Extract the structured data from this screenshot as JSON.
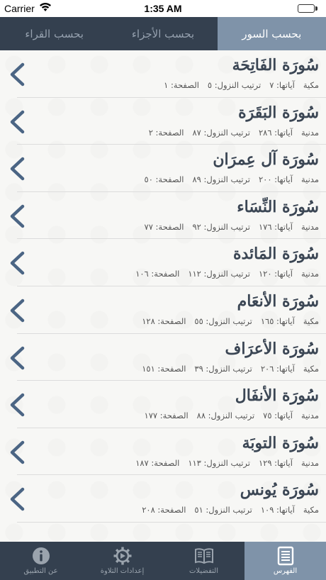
{
  "status_bar": {
    "carrier": "Carrier",
    "time": "1:35 AM"
  },
  "tabs": [
    {
      "label": "بحسب القراء",
      "active": false
    },
    {
      "label": "بحسب الأجزاء",
      "active": false
    },
    {
      "label": "بحسب السور",
      "active": true
    }
  ],
  "surahs": [
    {
      "name": "سُورَة الفَاتِحَة",
      "type": "مكية",
      "ayat": "آياتها: ٧",
      "order": "ترتيب النزول: ٥",
      "page": "الصفحة: ١"
    },
    {
      "name": "سُورَة البَقَرَة",
      "type": "مدنية",
      "ayat": "آياتها: ٢٨٦",
      "order": "ترتيب النزول: ٨٧",
      "page": "الصفحة: ٢"
    },
    {
      "name": "سُورَة آل عِمرَان",
      "type": "مدنية",
      "ayat": "آياتها: ٢٠٠",
      "order": "ترتيب النزول: ٨٩",
      "page": "الصفحة: ٥٠"
    },
    {
      "name": "سُورَة النِّسَاء",
      "type": "مدنية",
      "ayat": "آياتها: ١٧٦",
      "order": "ترتيب النزول: ٩٢",
      "page": "الصفحة: ٧٧"
    },
    {
      "name": "سُورَة المَائدة",
      "type": "مدنية",
      "ayat": "آياتها: ١٢٠",
      "order": "ترتيب النزول: ١١٢",
      "page": "الصفحة: ١٠٦"
    },
    {
      "name": "سُورَة الأنعَام",
      "type": "مكية",
      "ayat": "آياتها: ١٦٥",
      "order": "ترتيب النزول: ٥٥",
      "page": "الصفحة: ١٢٨"
    },
    {
      "name": "سُورَة الأعرَاف",
      "type": "مكية",
      "ayat": "آياتها: ٢٠٦",
      "order": "ترتيب النزول: ٣٩",
      "page": "الصفحة: ١٥١"
    },
    {
      "name": "سُورَة الأنفَال",
      "type": "مدنية",
      "ayat": "آياتها: ٧٥",
      "order": "ترتيب النزول: ٨٨",
      "page": "الصفحة: ١٧٧"
    },
    {
      "name": "سُورَة التوبَة",
      "type": "مدنية",
      "ayat": "آياتها: ١٢٩",
      "order": "ترتيب النزول: ١١٣",
      "page": "الصفحة: ١٨٧"
    },
    {
      "name": "سُورَة يُونس",
      "type": "مكية",
      "ayat": "آياتها: ١٠٩",
      "order": "ترتيب النزول: ٥١",
      "page": "الصفحة: ٢٠٨"
    }
  ],
  "tabbar": [
    {
      "label": "عن التطبيق",
      "icon": "info-icon",
      "active": false
    },
    {
      "label": "إعدادات التلاوة",
      "icon": "gear-icon",
      "active": false
    },
    {
      "label": "التفضيلات",
      "icon": "book-icon",
      "active": false
    },
    {
      "label": "الفهرس",
      "icon": "index-list-icon",
      "active": true
    }
  ],
  "colors": {
    "nav": "#34404f",
    "accent": "#7f93a9",
    "chevron": "#4b6584",
    "title": "#3b4654"
  }
}
